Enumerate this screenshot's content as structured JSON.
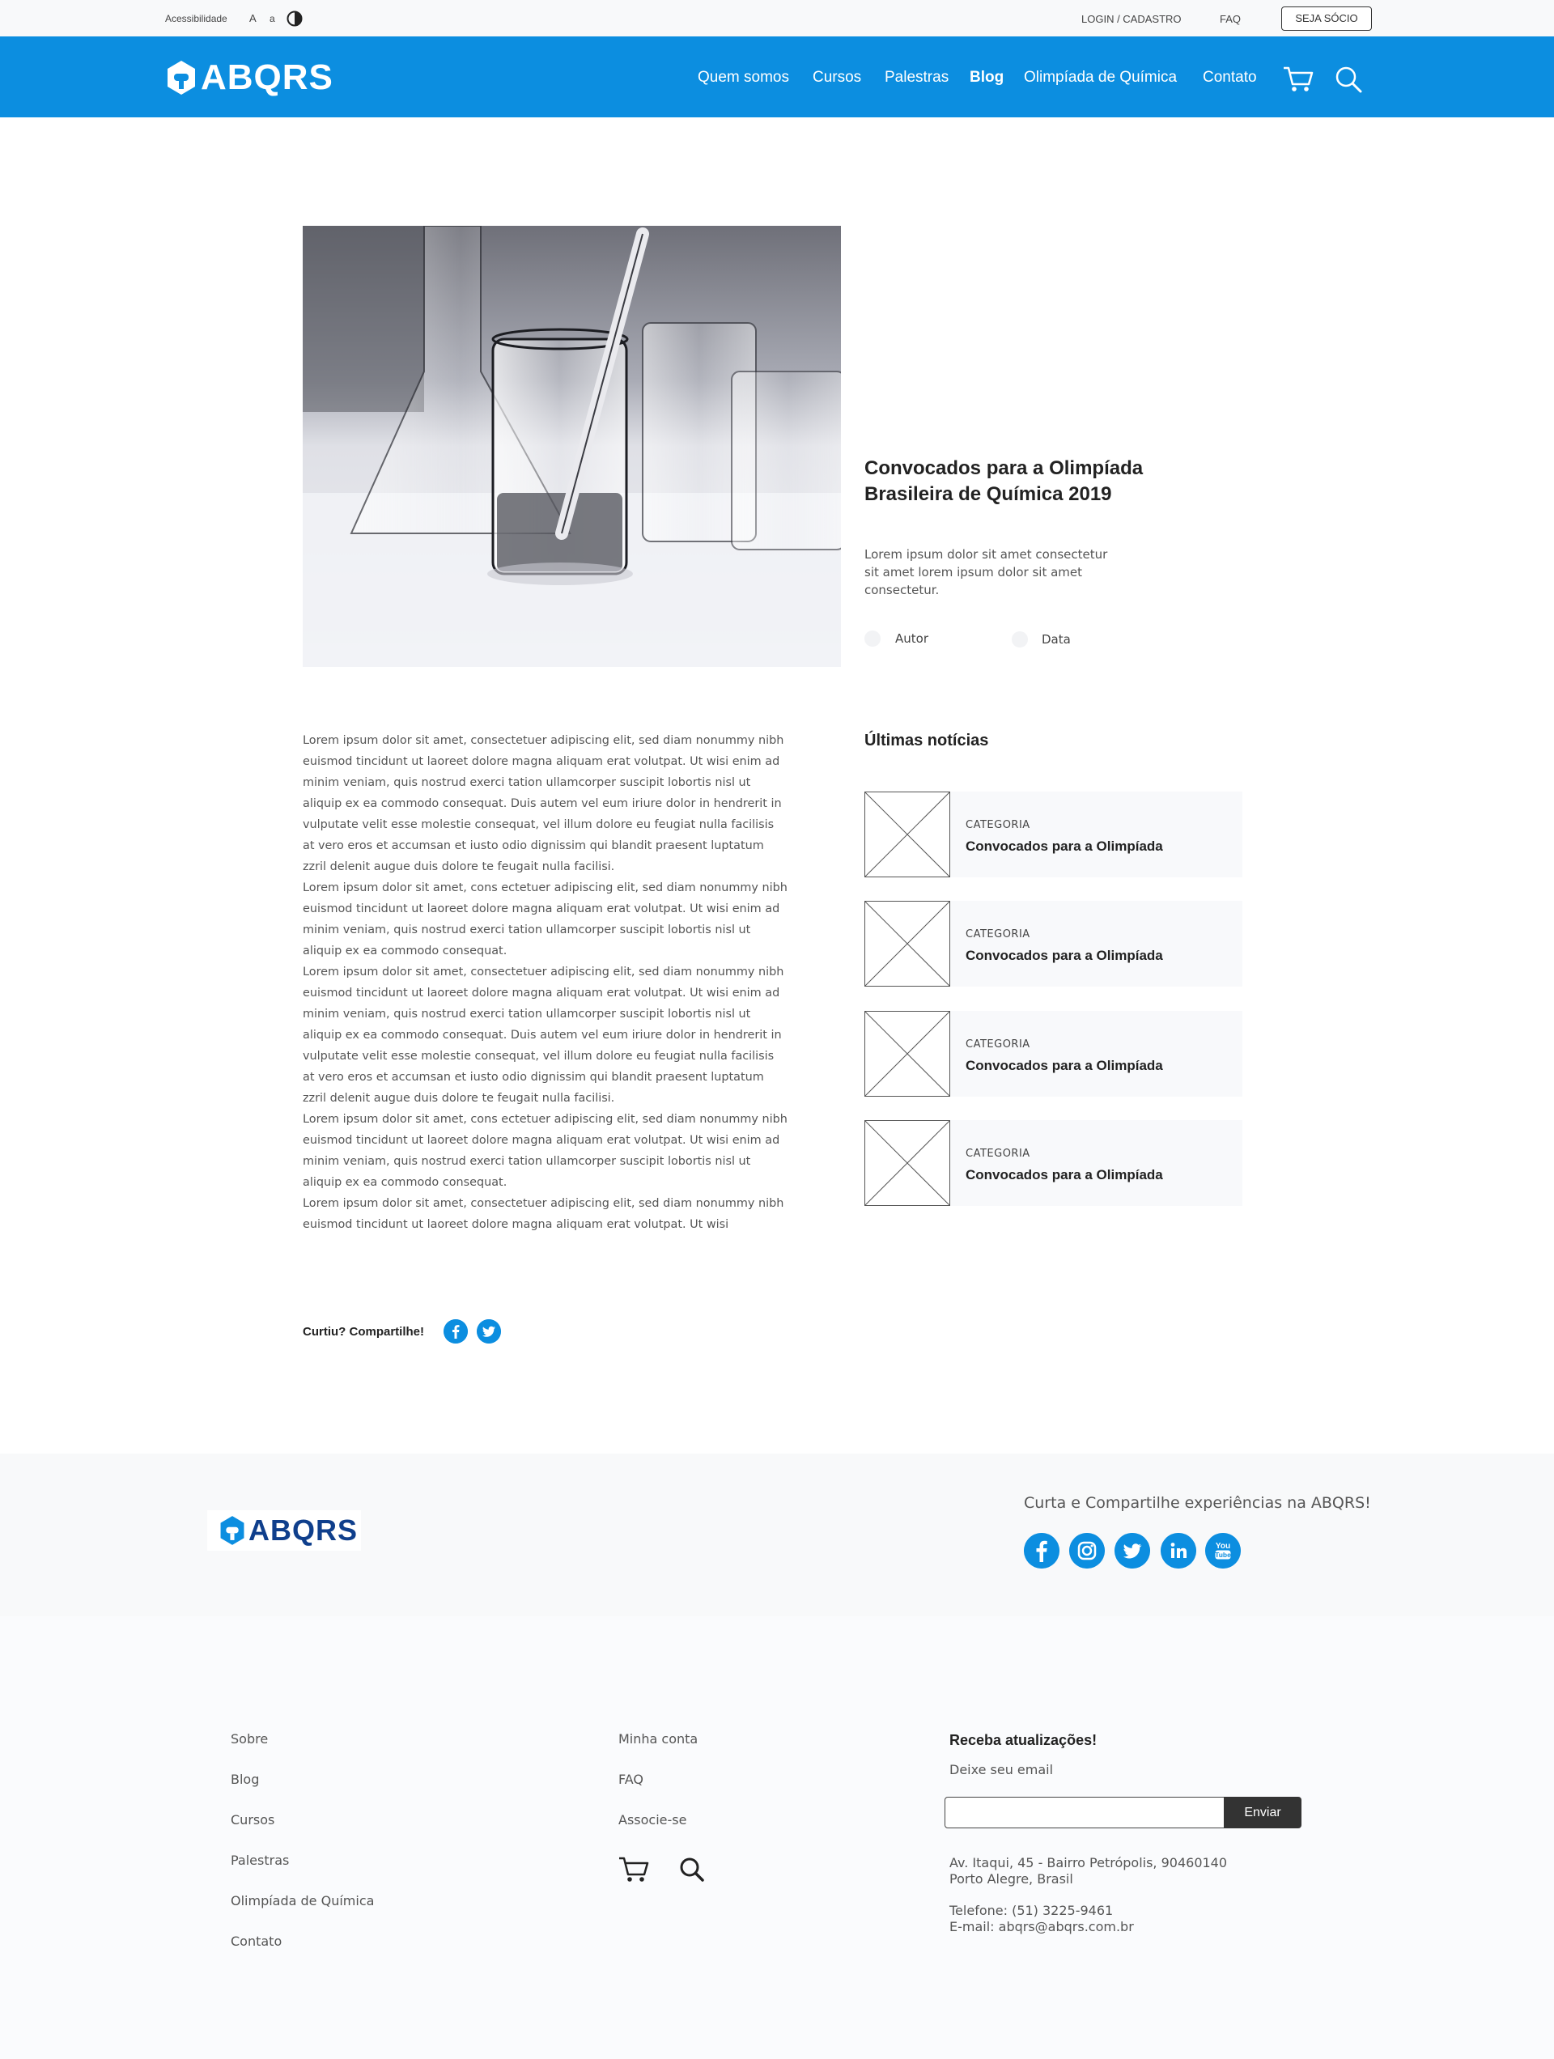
{
  "topbar": {
    "accessibility_label": "Acessibilidade",
    "font_increase": "A",
    "font_decrease": "a",
    "login_label": "LOGIN / CADASTRO",
    "faq_label": "FAQ",
    "member_button": "SEJA SÓCIO"
  },
  "nav": {
    "logo_text": "ABQRS",
    "items": [
      {
        "label": "Quem somos",
        "active": false
      },
      {
        "label": "Cursos",
        "active": false
      },
      {
        "label": "Palestras",
        "active": false
      },
      {
        "label": "Blog",
        "active": true
      },
      {
        "label": "Olimpíada de Química",
        "active": false
      },
      {
        "label": "Contato",
        "active": false
      }
    ],
    "icons": [
      "cart-icon",
      "search-icon"
    ],
    "brand_color": "#0c8ee0"
  },
  "hero": {
    "title": "Convocados para a Olimpíada Brasileira de Química 2019",
    "excerpt": "Lorem ipsum dolor sit amet consectetur sit amet lorem ipsum dolor sit amet consectetur.",
    "author_label": "Autor",
    "date_label": "Data"
  },
  "article": {
    "paragraphs": [
      "Lorem ipsum dolor sit amet, consectetuer adipiscing elit, sed diam nonummy nibh euismod tincidunt ut laoreet dolore magna aliquam erat volutpat. Ut wisi enim ad minim veniam, quis nostrud exerci tation ullamcorper suscipit lobortis nisl ut aliquip ex ea commodo consequat. Duis autem vel eum iriure dolor in hendrerit in vulputate velit esse molestie consequat, vel illum dolore eu feugiat nulla facilisis at vero eros et accumsan et iusto odio dignissim qui blandit praesent luptatum zzril delenit augue duis dolore te feugait nulla facilisi.",
      "Lorem ipsum dolor sit amet, cons ectetuer adipiscing elit, sed diam nonummy nibh euismod tincidunt ut laoreet dolore magna aliquam erat volutpat. Ut wisi enim ad minim veniam, quis nostrud exerci tation ullamcorper suscipit lobortis nisl ut aliquip ex ea commodo consequat.",
      "Lorem ipsum dolor sit amet, consectetuer adipiscing elit, sed diam nonummy nibh euismod tincidunt ut laoreet dolore magna aliquam erat volutpat. Ut wisi enim ad minim veniam, quis nostrud exerci tation ullamcorper suscipit lobortis nisl ut aliquip ex ea commodo consequat. Duis autem vel eum iriure dolor in hendrerit in vulputate velit esse molestie consequat, vel illum dolore eu feugiat nulla facilisis at vero eros et accumsan et iusto odio dignissim qui blandit praesent luptatum zzril delenit augue duis dolore te feugait nulla facilisi.",
      "Lorem ipsum dolor sit amet, cons ectetuer adipiscing elit, sed diam nonummy nibh euismod tincidunt ut laoreet dolore magna aliquam erat volutpat. Ut wisi enim ad minim veniam, quis nostrud exerci tation ullamcorper suscipit lobortis nisl ut aliquip ex ea commodo consequat.",
      "Lorem ipsum dolor sit amet, consectetuer adipiscing elit, sed diam nonummy nibh euismod tincidunt ut laoreet dolore magna aliquam erat volutpat. Ut wisi"
    ]
  },
  "sidebar": {
    "title": "Últimas notícias",
    "items": [
      {
        "category": "CATEGORIA",
        "title": "Convocados para a Olimpíada"
      },
      {
        "category": "CATEGORIA",
        "title": "Convocados para a Olimpíada"
      },
      {
        "category": "CATEGORIA",
        "title": "Convocados para a Olimpíada"
      },
      {
        "category": "CATEGORIA",
        "title": "Convocados para a Olimpíada"
      }
    ]
  },
  "share": {
    "label": "Curtiu? Compartilhe!",
    "icons": [
      "facebook-icon",
      "twitter-icon"
    ]
  },
  "footer_band": {
    "logo_text": "ABQRS",
    "tagline": "Curta e Compartilhe experiências na ABQRS!",
    "social": [
      "facebook-icon",
      "instagram-icon",
      "twitter-icon",
      "linkedin-icon",
      "youtube-icon"
    ],
    "logo_color": "#0f3f8c"
  },
  "footer": {
    "col1": [
      "Sobre",
      "Blog",
      "Cursos",
      "Palestras",
      "Olimpíada de Química",
      "Contato"
    ],
    "col2": [
      "Minha conta",
      "FAQ",
      "Associe-se"
    ],
    "newsletter_title": "Receba atualizações!",
    "newsletter_sub": "Deixe seu email",
    "email_placeholder": "",
    "send_label": "Enviar",
    "address_line1": "Av. Itaqui, 45 - Bairro Petrópolis, 90460140",
    "address_line2": "Porto Alegre, Brasil",
    "phone": "Telefone: (51) 3225-9461",
    "email": "E-mail: abqrs@abqrs.com.br"
  }
}
